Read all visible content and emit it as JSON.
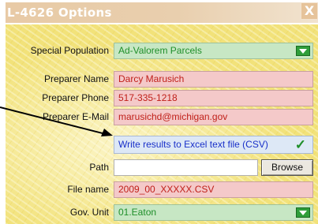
{
  "window": {
    "title": "L-4626 Options",
    "close_glyph": "X"
  },
  "form": {
    "special_population": {
      "label": "Special Population",
      "value": "Ad-Valorem Parcels"
    },
    "preparer_name": {
      "label": "Preparer Name",
      "value": "Darcy Marusich"
    },
    "preparer_phone": {
      "label": "Preparer Phone",
      "value": "517-335-1218"
    },
    "preparer_email": {
      "label": "Preparer E-Mail",
      "value": "marusichd@michigan.gov"
    },
    "write_csv": {
      "label": "Write results to Excel text file (CSV)",
      "checked": true
    },
    "path": {
      "label": "Path",
      "value": "",
      "browse_label": "Browse"
    },
    "file_name": {
      "label": "File name",
      "value": "2009_00_XXXXX.CSV"
    },
    "gov_unit": {
      "label": "Gov. Unit",
      "value": "01.Eaton"
    }
  },
  "icons": {
    "dropdown": "chevron-down-icon",
    "check": "checkmark-icon",
    "annotation": "pointer-arrow"
  },
  "colors": {
    "panel_background": "#f2e27a",
    "title_bar": "#e8caa6",
    "field_pink": "#f4c9c9",
    "field_green": "#c7e7c4",
    "field_blue": "#dde8f6",
    "text_red": "#c0201a",
    "text_green": "#1f8f2a",
    "text_blue": "#1930c9"
  }
}
